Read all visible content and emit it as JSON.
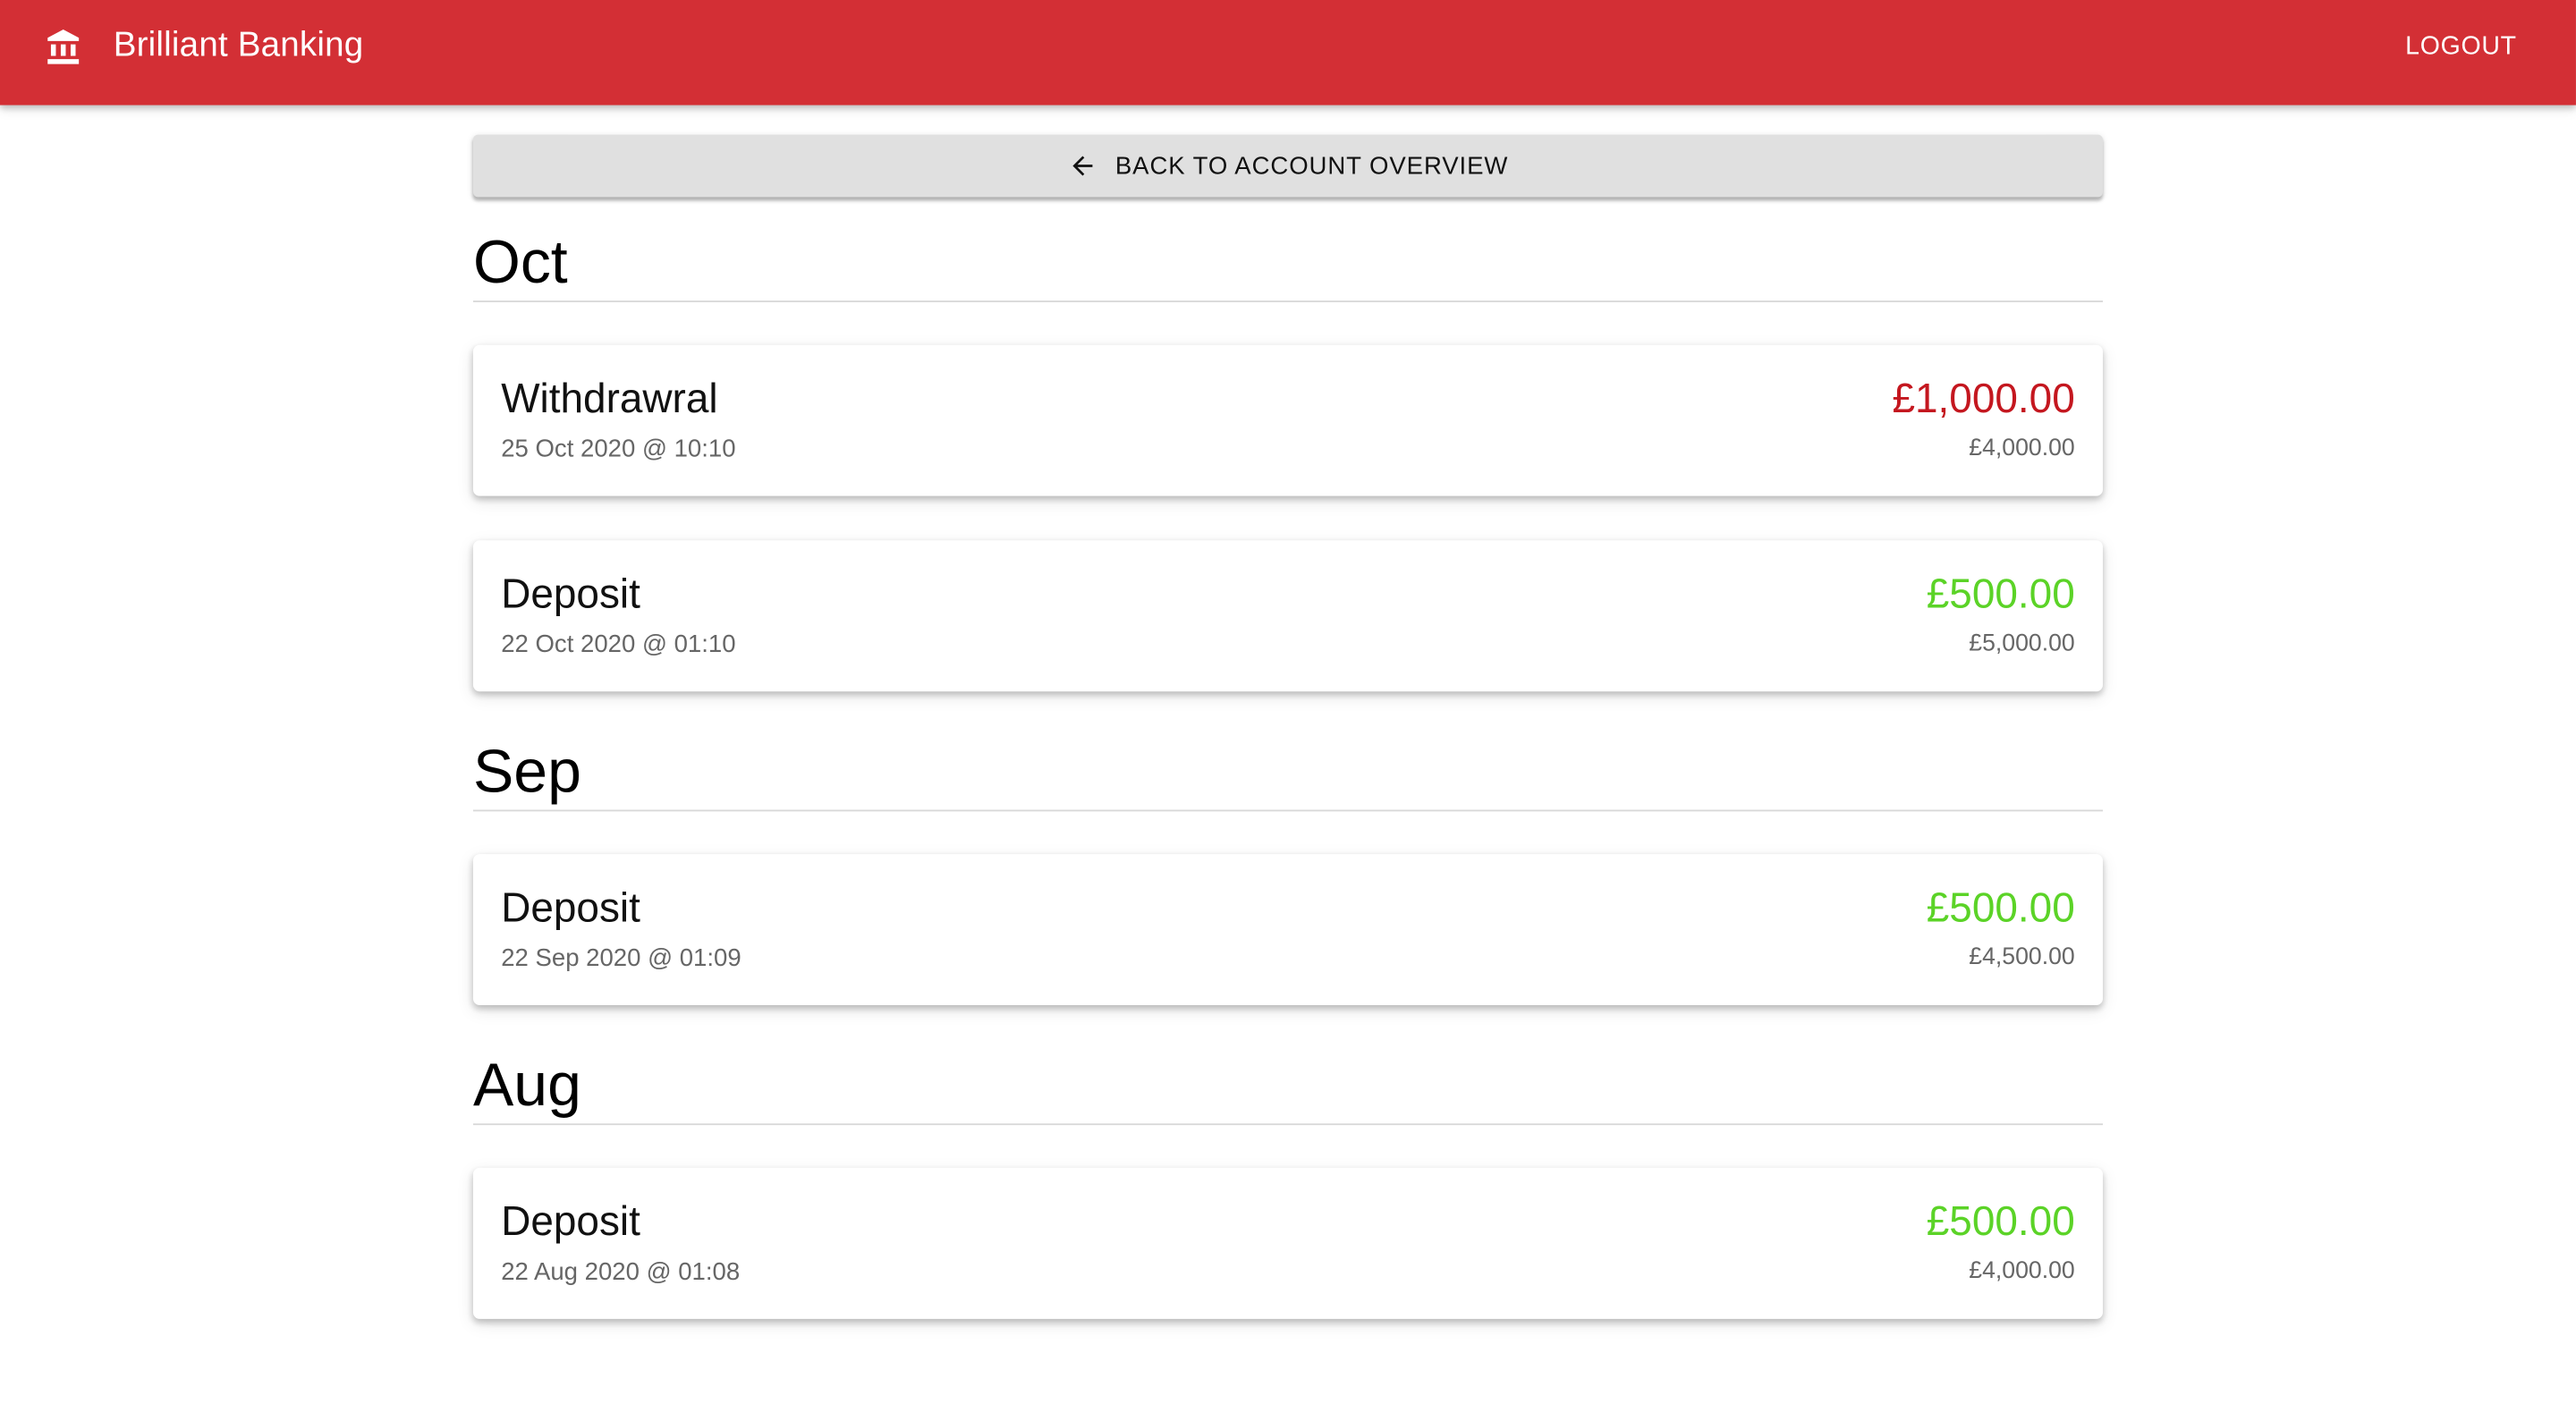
{
  "header": {
    "app_title": "Brilliant Banking",
    "brand_icon": "bank-icon",
    "logout_label": "LOGOUT",
    "bar_color": "#d32f35"
  },
  "nav": {
    "back_label": "BACK TO ACCOUNT OVERVIEW",
    "back_icon": "arrow-left-icon"
  },
  "months": [
    {
      "label": "Oct",
      "transactions": [
        {
          "title": "Withdrawral",
          "date": "25 Oct 2020 @ 10:10",
          "amount": "£1,000.00",
          "balance": "£4,000.00",
          "kind": "withdrawal",
          "amount_color": "#c4171f"
        },
        {
          "title": "Deposit",
          "date": "22 Oct 2020 @ 01:10",
          "amount": "£500.00",
          "balance": "£5,000.00",
          "kind": "deposit",
          "amount_color": "#5bd327"
        }
      ]
    },
    {
      "label": "Sep",
      "transactions": [
        {
          "title": "Deposit",
          "date": "22 Sep 2020 @ 01:09",
          "amount": "£500.00",
          "balance": "£4,500.00",
          "kind": "deposit",
          "amount_color": "#5bd327"
        }
      ]
    },
    {
      "label": "Aug",
      "transactions": [
        {
          "title": "Deposit",
          "date": "22 Aug 2020 @ 01:08",
          "amount": "£500.00",
          "balance": "£4,000.00",
          "kind": "deposit",
          "amount_color": "#5bd327"
        }
      ]
    }
  ]
}
